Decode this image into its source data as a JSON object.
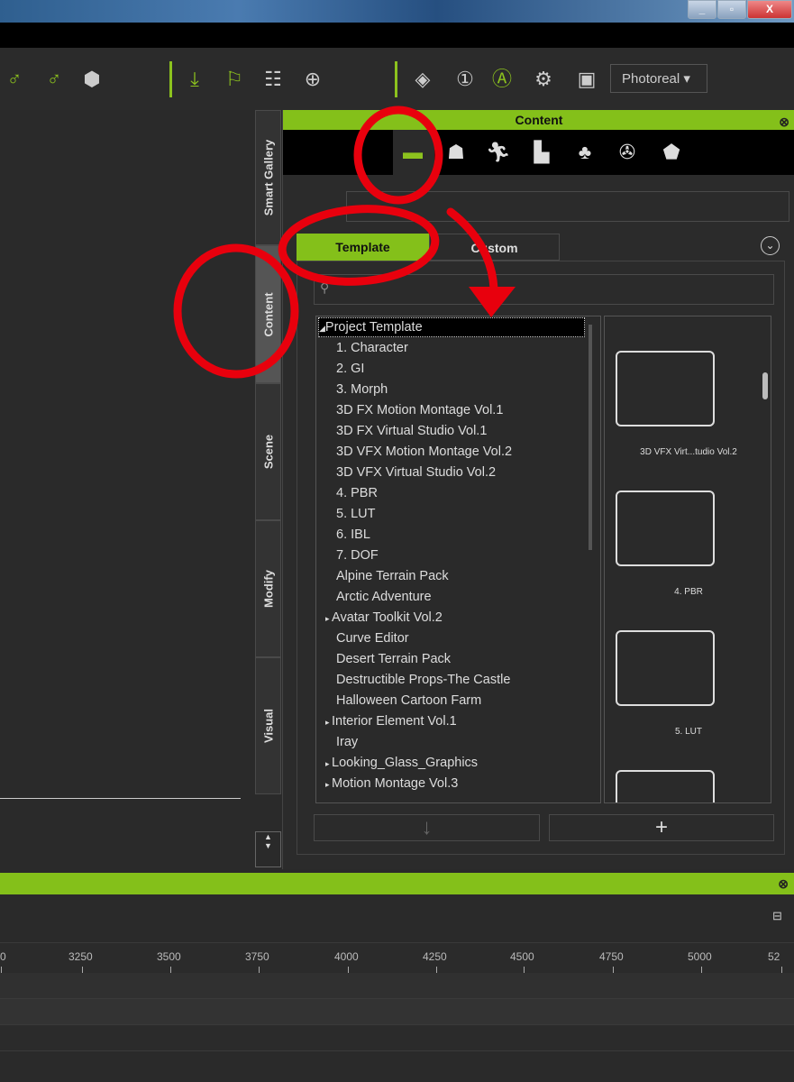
{
  "window": {
    "minimize": "_",
    "restore": "▫",
    "close": "X"
  },
  "toolbar": {
    "render_mode": "Photoreal",
    "render_caret": "▾"
  },
  "side_tabs": [
    "Smart Gallery",
    "Content",
    "Scene",
    "Modify",
    "Visual"
  ],
  "content": {
    "title": "Content",
    "close": "⊗",
    "tabs": [
      "Template",
      "Custom"
    ],
    "chevron": "⌄",
    "tree": [
      {
        "label": "Project Template",
        "expanded": true,
        "level": 0,
        "selected": true
      },
      {
        "label": "1. Character",
        "level": 1
      },
      {
        "label": "2. GI",
        "level": 1
      },
      {
        "label": "3. Morph",
        "level": 1
      },
      {
        "label": "3D FX Motion Montage Vol.1",
        "level": 1
      },
      {
        "label": "3D FX Virtual Studio Vol.1",
        "level": 1
      },
      {
        "label": "3D VFX Motion Montage Vol.2",
        "level": 1
      },
      {
        "label": "3D VFX Virtual Studio Vol.2",
        "level": 1
      },
      {
        "label": "4. PBR",
        "level": 1
      },
      {
        "label": "5. LUT",
        "level": 1
      },
      {
        "label": "6. IBL",
        "level": 1
      },
      {
        "label": "7. DOF",
        "level": 1
      },
      {
        "label": "Alpine Terrain Pack",
        "level": 1
      },
      {
        "label": "Arctic Adventure",
        "level": 1
      },
      {
        "label": "Avatar Toolkit Vol.2",
        "level": 1,
        "collapsed": true
      },
      {
        "label": "Curve Editor",
        "level": 1
      },
      {
        "label": "Desert Terrain Pack",
        "level": 1
      },
      {
        "label": "Destructible Props-The Castle",
        "level": 1
      },
      {
        "label": "Halloween Cartoon Farm",
        "level": 1
      },
      {
        "label": "Interior Element Vol.1",
        "level": 1,
        "collapsed": true
      },
      {
        "label": "Iray",
        "level": 1
      },
      {
        "label": "Looking_Glass_Graphics",
        "level": 1,
        "collapsed": true
      },
      {
        "label": "Motion Montage Vol.3",
        "level": 1,
        "collapsed": true
      }
    ],
    "thumbnails": [
      "3D VFX Virt...tudio Vol.2",
      "4. PBR",
      "5. LUT"
    ],
    "buttons": {
      "down": "↓",
      "add": "+"
    }
  },
  "timeline": {
    "close": "⊗",
    "ticks": [
      "0",
      "3250",
      "3500",
      "3750",
      "4000",
      "4250",
      "4500",
      "4750",
      "5000",
      "52"
    ]
  },
  "colors": {
    "accent": "#84c01a",
    "annotation": "#e8000d"
  }
}
